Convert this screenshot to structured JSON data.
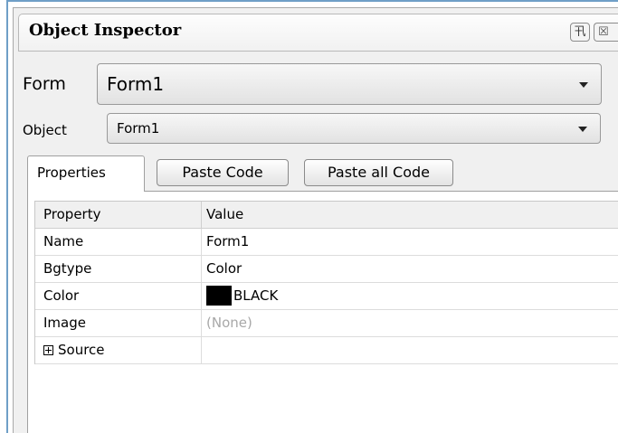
{
  "panel": {
    "title": "Object Inspector",
    "pin_glyph": "卂",
    "close_glyph": "☒"
  },
  "form_selector": {
    "label": "Form",
    "value": "Form1"
  },
  "object_selector": {
    "label": "Object",
    "value": "Form1"
  },
  "tabs": {
    "properties_label": "Properties",
    "paste_code_label": "Paste Code",
    "paste_all_code_label": "Paste all Code"
  },
  "grid": {
    "columns": [
      "Property",
      "Value"
    ],
    "rows": [
      {
        "property": "Name",
        "value": "Form1"
      },
      {
        "property": "Bgtype",
        "value": "Color"
      },
      {
        "property": "Color",
        "value": "BLACK",
        "swatch_color": "#000000"
      },
      {
        "property": "Image",
        "value": "(None)"
      },
      {
        "property": "Source",
        "value": ""
      }
    ]
  }
}
